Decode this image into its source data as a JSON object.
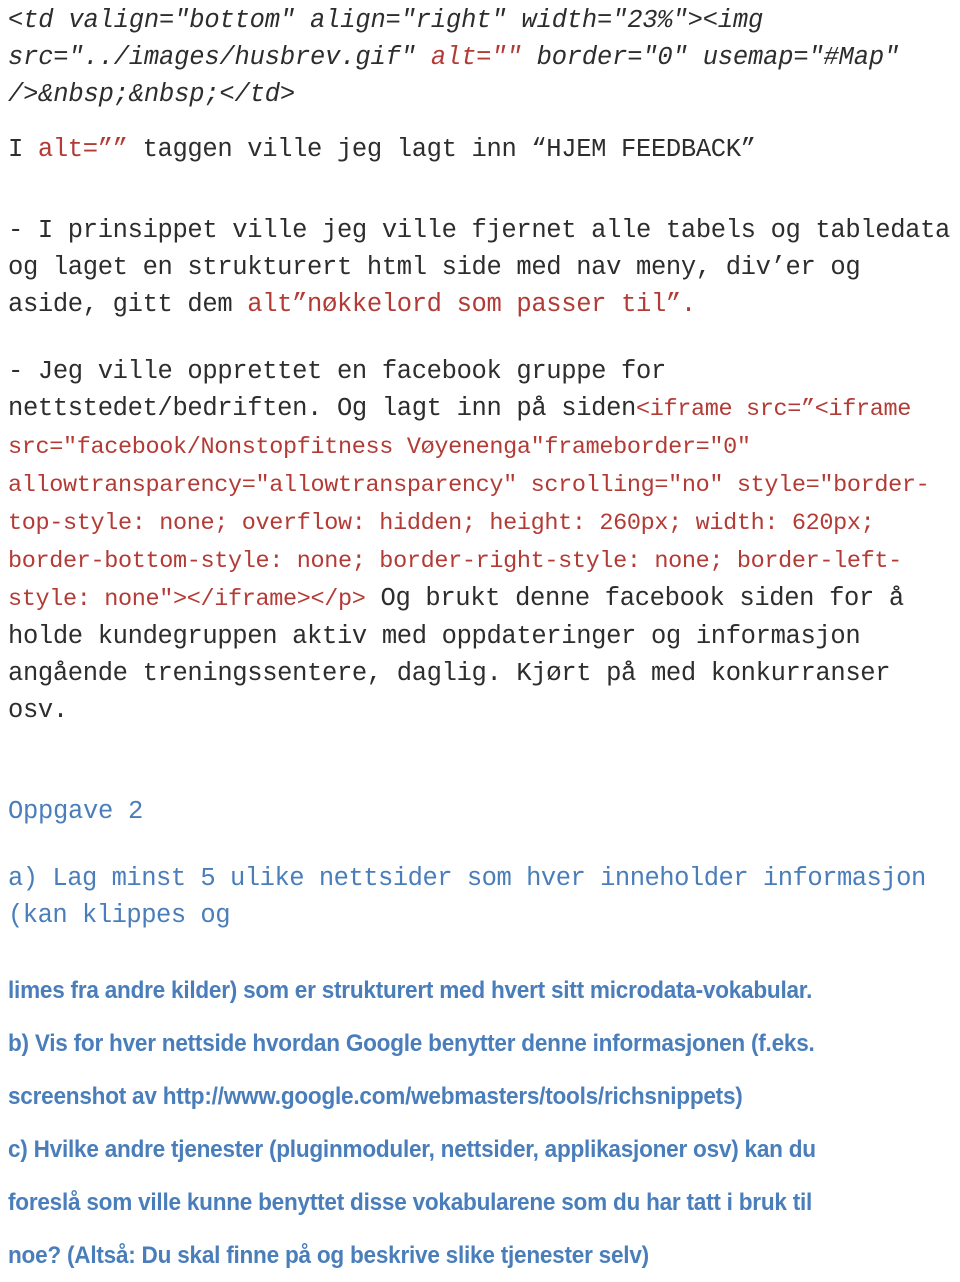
{
  "document": {
    "colors": {
      "text": "#2d2d2d",
      "code_red": "#b33b36",
      "heading_blue": "#4a7ebb",
      "background": "#ffffff"
    },
    "blocks": [
      {
        "id": "td-code",
        "style": "code-italic-mono",
        "text": "<td valign=\"bottom\" align=\"right\" width=\"23%\"><img src=\"../images/husbrev.gif\" alt=\"\" border=\"0\" usemap=\"#Map\" />&nbsp;&nbsp;</td>"
      },
      {
        "id": "alt-tag-line",
        "style": "prose-mono",
        "text": "I alt=\"\" taggen ville jeg lagt inn “HJEM FEEDBACK”"
      },
      {
        "id": "prinsippet",
        "style": "prose-mono",
        "text": "- I prinsippet ville jeg ville fjernet alle tabels og tabledata og laget en strukturert html side med nav meny, div’er og aside, gitt dem alt”nøkkelord som passer til”."
      },
      {
        "id": "facebook-gruppe",
        "style": "prose-mono",
        "text": "- Jeg ville opprettet en facebook gruppe for nettstedet/bedriften. Og lagt inn på siden"
      },
      {
        "id": "iframe-code",
        "style": "code-red",
        "text": "<iframe src=”<iframe src=\"facebook/Nonstopfitness Vøyenenga\"frameborder=\"0\" allowtransparency=\"allowtransparency\" scrolling=\"no\" style=\"border-top-style: none; overflow: hidden; height: 260px; width: 620px; border-bottom-style: none; border-right-style: none; border-left-style: none\"></iframe></p>"
      },
      {
        "id": "facebook-bruk",
        "style": "prose-mono",
        "text": "Og brukt denne facebook siden for å holde kundegruppen aktiv med oppdateringer og informasjon angående treningssentere, daglig. Kjørt på med konkurranser osv."
      }
    ],
    "segments": {
      "td_code": {
        "part1": "<td valign=\"bottom\" align=\"right\" width=\"23%\"><img src=\"../images/husbrev.gif\" ",
        "red": "alt=\"\"",
        "part2": " border=\"0\" usemap=\"#Map\" />&nbsp;&nbsp;</td>"
      },
      "alt_tag": {
        "pre": "I ",
        "red": "alt=””",
        "post": " taggen ville jeg lagt inn “HJEM FEEDBACK”"
      },
      "prinsippet": {
        "pre": "- I prinsippet ville jeg ville fjernet alle tabels og tabledata og laget en strukturert html side med nav meny, div’er og aside, gitt dem ",
        "red": "alt”nøkkelord som passer til”."
      },
      "facebook": {
        "pre": "- Jeg ville opprettet en facebook gruppe for nettstedet/bedriften. Og lagt inn på siden",
        "red": "<iframe src=”<iframe src=\"facebook/Nonstopfitness Vøyenenga\"frameborder=\"0\" allowtransparency=\"allowtransparency\" scrolling=\"no\" style=\"border-top-style: none; overflow: hidden; height: 260px; width: 620px; border-bottom-style: none; border-right-style: none; border-left-style: none\"></iframe></p>",
        "post": " Og brukt denne facebook siden for å holde kundegruppen aktiv med oppdateringer og informasjon angående treningssentere, daglig. Kjørt på med konkurranser osv."
      }
    },
    "heading": {
      "text": "Oppgave 2"
    },
    "questions": [
      {
        "id": "q-a-mono",
        "style": "mono-blue",
        "text": "a) Lag minst 5 ulike nettsider som hver inneholder informasjon (kan klippes og"
      },
      {
        "id": "q-a-cont",
        "style": "sans-blue",
        "text": "limes fra andre kilder) som er strukturert med hvert sitt microdata-vokabular."
      },
      {
        "id": "q-b-1",
        "style": "sans-blue",
        "text": "b) Vis for hver nettside hvordan Google benytter denne informasjonen (f.eks."
      },
      {
        "id": "q-b-2",
        "style": "sans-blue",
        "text": "screenshot av http://www.google.com/webmasters/tools/richsnippets)"
      },
      {
        "id": "q-c-1",
        "style": "sans-blue",
        "text": "c) Hvilke andre tjenester (pluginmoduler, nettsider, applikasjoner osv) kan du"
      },
      {
        "id": "q-c-2",
        "style": "sans-blue",
        "text": "foreslå som ville kunne benyttet disse vokabularene som du har tatt i bruk til"
      },
      {
        "id": "q-c-3",
        "style": "sans-blue",
        "text": "noe? (Altså: Du skal finne på og beskrive slike tjenester selv)"
      }
    ]
  }
}
